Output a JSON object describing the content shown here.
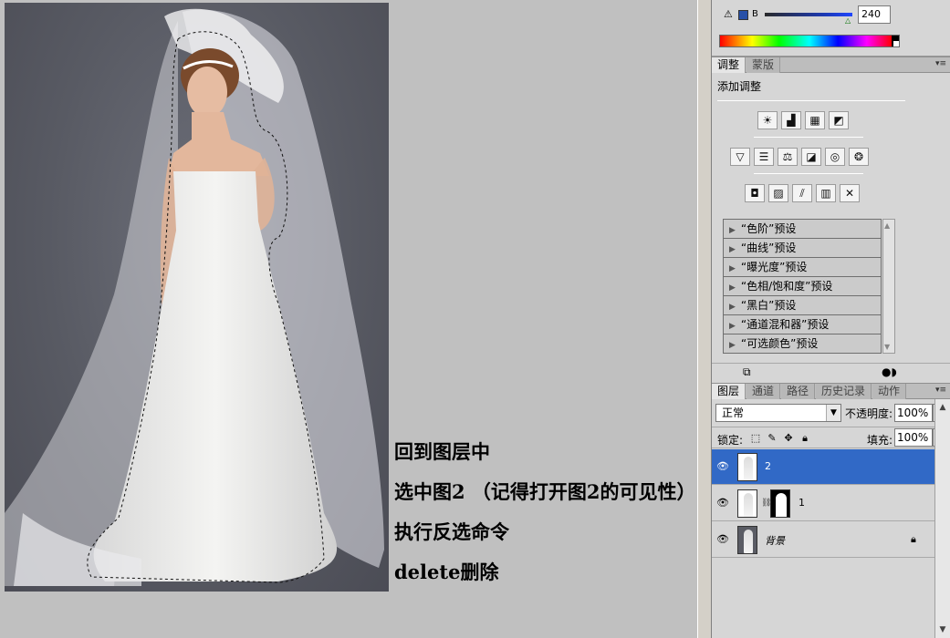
{
  "color_panel": {
    "warning_icon": "gamut-warning-icon",
    "channel_label": "B",
    "channel_value": "240",
    "blue_color": "#2850a8"
  },
  "adjustments": {
    "tabs": [
      "调整",
      "蒙版"
    ],
    "title": "添加调整",
    "presets": [
      "“色阶”预设",
      "“曲线”预设",
      "“曝光度”预设",
      "“色相/饱和度”预设",
      "“黑白”预设",
      "“通道混和器”预设",
      "“可选颜色”预设"
    ]
  },
  "layers_panel": {
    "tabs": [
      "图层",
      "通道",
      "路径",
      "历史记录",
      "动作"
    ],
    "blend_mode": "正常",
    "opacity_label": "不透明度:",
    "opacity_value": "100%",
    "lock_label": "锁定:",
    "fill_label": "填充:",
    "fill_value": "100%",
    "layers": [
      {
        "name": "2",
        "selected": true
      },
      {
        "name": "1",
        "selected": false
      },
      {
        "name": "背景",
        "selected": false
      }
    ],
    "selection_color": "#3169c6"
  },
  "instructions": {
    "line1": "回到图层中",
    "line2": "选中图2 （记得打开图2的可见性）",
    "line3": "执行反选命令",
    "line4": "delete删除"
  }
}
